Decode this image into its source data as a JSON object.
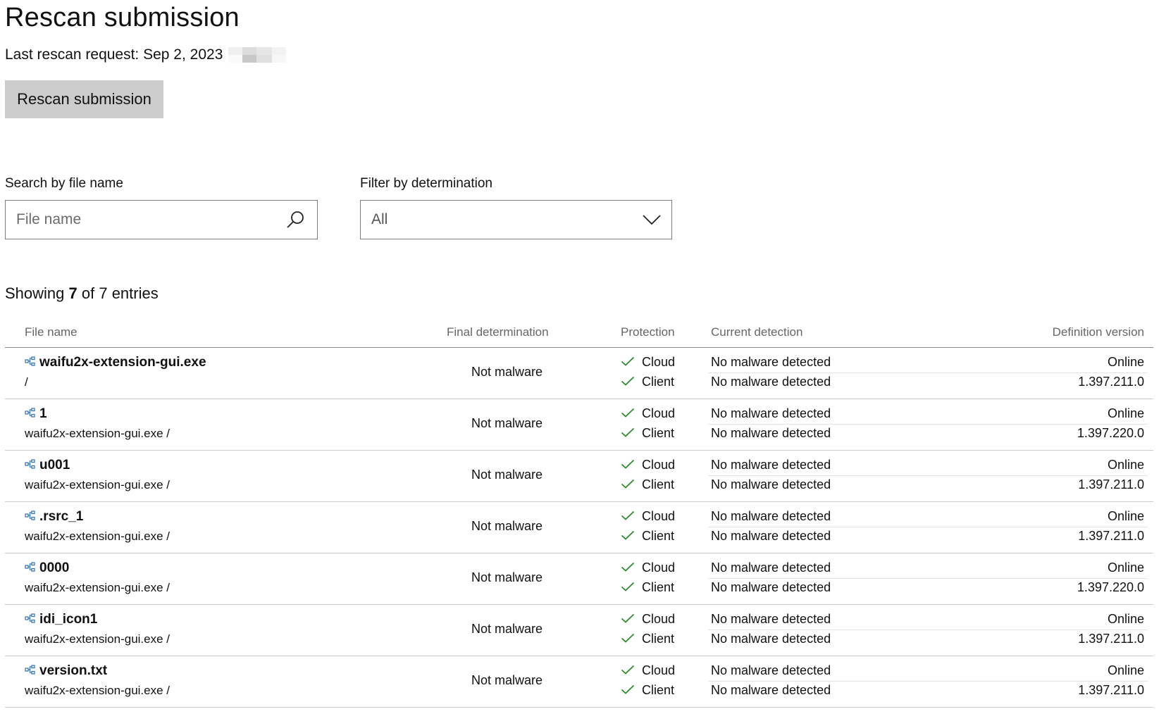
{
  "header": {
    "title": "Rescan submission",
    "last_rescan_label": "Last rescan request: Sep 2, 2023",
    "rescan_button": "Rescan submission"
  },
  "search": {
    "label": "Search by file name",
    "placeholder": "File name",
    "icon": "search-icon"
  },
  "filter": {
    "label": "Filter by determination",
    "selected": "All",
    "icon": "chevron-down-icon"
  },
  "summary": {
    "prefix": "Showing",
    "shown": "7",
    "middle": "of 7 entries"
  },
  "table": {
    "columns": {
      "file_name": "File name",
      "final_determination": "Final determination",
      "protection": "Protection",
      "current_detection": "Current detection",
      "definition_version": "Definition version"
    },
    "rows": [
      {
        "name": "waifu2x-extension-gui.exe",
        "path": "/",
        "final": "Not malware",
        "cloud_label": "Cloud",
        "client_label": "Client",
        "cloud_detection": "No malware detected",
        "client_detection": "No malware detected",
        "cloud_version": "Online",
        "client_version": "1.397.211.0"
      },
      {
        "name": "1",
        "path": "waifu2x-extension-gui.exe /",
        "final": "Not malware",
        "cloud_label": "Cloud",
        "client_label": "Client",
        "cloud_detection": "No malware detected",
        "client_detection": "No malware detected",
        "cloud_version": "Online",
        "client_version": "1.397.220.0"
      },
      {
        "name": "u001",
        "path": "waifu2x-extension-gui.exe /",
        "final": "Not malware",
        "cloud_label": "Cloud",
        "client_label": "Client",
        "cloud_detection": "No malware detected",
        "client_detection": "No malware detected",
        "cloud_version": "Online",
        "client_version": "1.397.211.0"
      },
      {
        "name": ".rsrc_1",
        "path": "waifu2x-extension-gui.exe /",
        "final": "Not malware",
        "cloud_label": "Cloud",
        "client_label": "Client",
        "cloud_detection": "No malware detected",
        "client_detection": "No malware detected",
        "cloud_version": "Online",
        "client_version": "1.397.211.0"
      },
      {
        "name": "0000",
        "path": "waifu2x-extension-gui.exe /",
        "final": "Not malware",
        "cloud_label": "Cloud",
        "client_label": "Client",
        "cloud_detection": "No malware detected",
        "client_detection": "No malware detected",
        "cloud_version": "Online",
        "client_version": "1.397.220.0"
      },
      {
        "name": "idi_icon1",
        "path": "waifu2x-extension-gui.exe /",
        "final": "Not malware",
        "cloud_label": "Cloud",
        "client_label": "Client",
        "cloud_detection": "No malware detected",
        "client_detection": "No malware detected",
        "cloud_version": "Online",
        "client_version": "1.397.211.0"
      },
      {
        "name": "version.txt",
        "path": "waifu2x-extension-gui.exe /",
        "final": "Not malware",
        "cloud_label": "Cloud",
        "client_label": "Client",
        "cloud_detection": "No malware detected",
        "client_detection": "No malware detected",
        "cloud_version": "Online",
        "client_version": "1.397.211.0"
      }
    ]
  },
  "colors": {
    "check": "#2e8b2e",
    "tree_icon": "#2f6fb5",
    "button_bg": "#cccccc"
  }
}
